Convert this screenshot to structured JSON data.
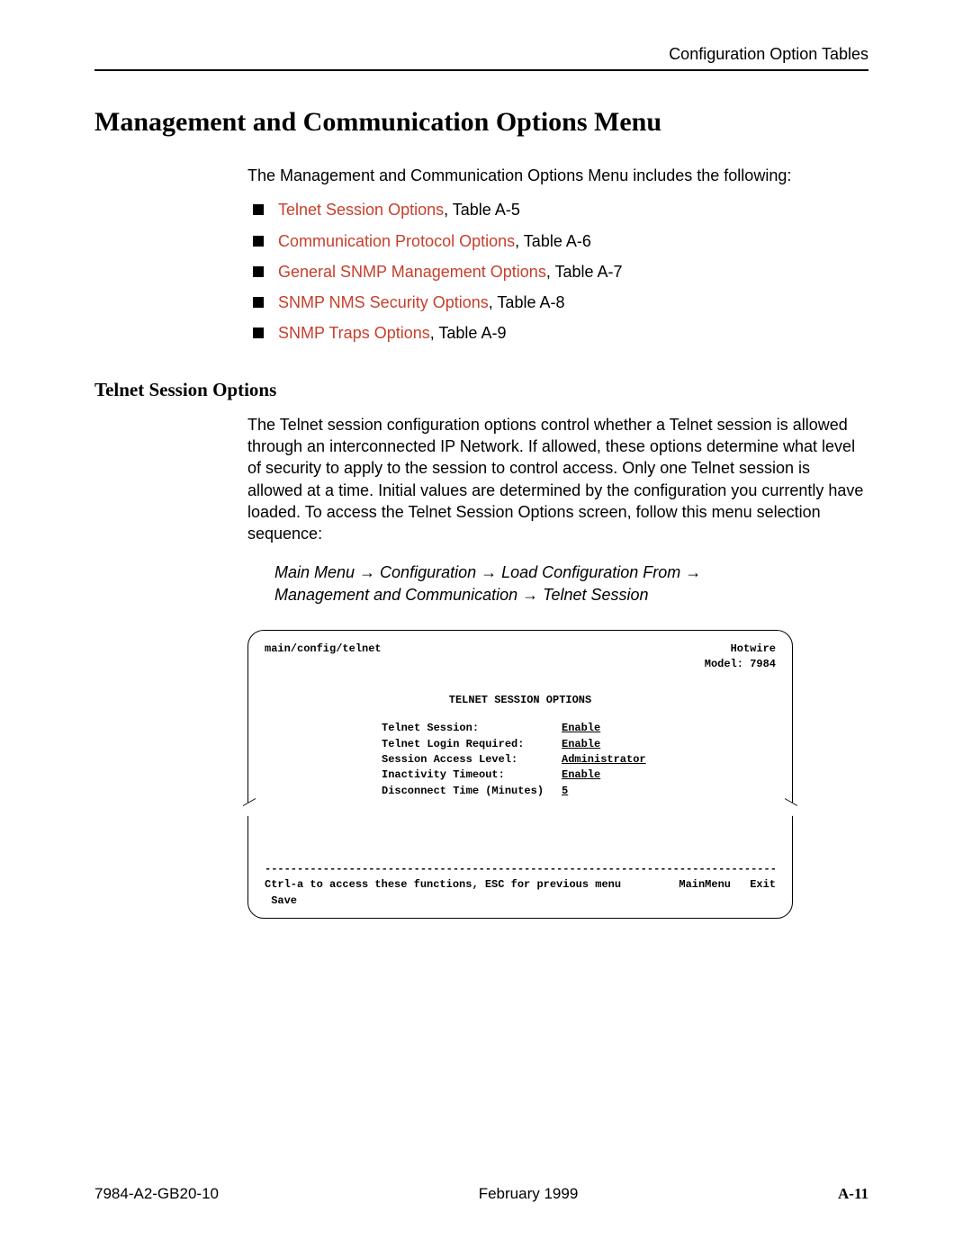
{
  "header": {
    "running_head": "Configuration Option Tables"
  },
  "title": "Management and Communication Options Menu",
  "intro": "The Management and Communication Options Menu includes the following:",
  "bullets": [
    {
      "link": "Telnet Session Options",
      "suffix": ", Table A-5"
    },
    {
      "link": "Communication Protocol Options",
      "suffix": ", Table A-6"
    },
    {
      "link": "General SNMP Management Options",
      "suffix": ", Table A-7"
    },
    {
      "link": "SNMP NMS Security Options",
      "suffix": ", Table A-8"
    },
    {
      "link": "SNMP Traps Options",
      "suffix": ", Table A-9"
    }
  ],
  "subsection": {
    "title": "Telnet Session Options",
    "para": "The Telnet session configuration options control whether a Telnet session is allowed through an interconnected IP Network. If allowed, these options determine what level of security to apply to the session to control access. Only one Telnet session is allowed at a time. Initial values are determined by the configuration you currently have loaded. To access the Telnet Session Options screen, follow this menu selection sequence:",
    "menu_seq_line1": "Main Menu → Configuration → Load Configuration From →",
    "menu_seq_line2": "Management and Communication → Telnet Session"
  },
  "terminal": {
    "path": "main/config/telnet",
    "brand": "Hotwire",
    "model": "Model: 7984",
    "screen_title": "TELNET SESSION OPTIONS",
    "options": [
      {
        "label": "Telnet Session:",
        "value": "Enable"
      },
      {
        "label": "Telnet Login Required:",
        "value": "Enable"
      },
      {
        "label": "Session Access Level:",
        "value": "Administrator"
      },
      {
        "label": "Inactivity Timeout:",
        "value": "Enable"
      },
      {
        "label": "Disconnect Time (Minutes)",
        "value": "5"
      }
    ],
    "dashline": "--------------------------------------------------------------------------------",
    "hint": "Ctrl-a to access these functions, ESC for previous menu",
    "action_main": "MainMenu",
    "action_exit": "Exit",
    "action_save": "Save"
  },
  "footer": {
    "doc_id": "7984-A2-GB20-10",
    "date": "February 1999",
    "page": "A-11"
  }
}
